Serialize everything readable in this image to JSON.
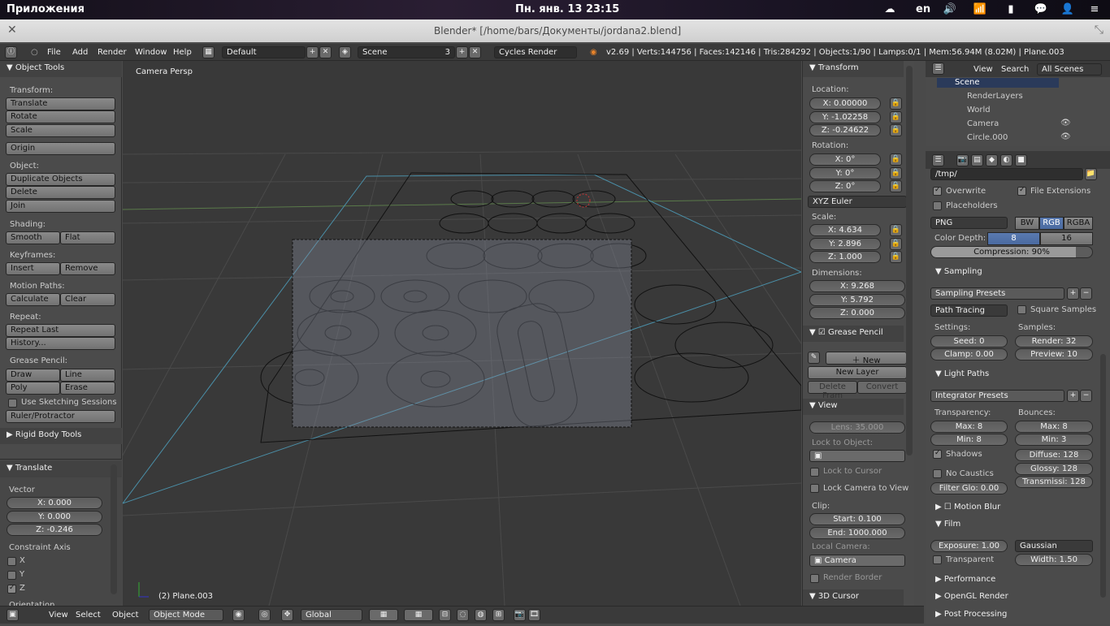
{
  "os": {
    "apps": "Приложения",
    "clock": "Пн. янв. 13 23:15",
    "lang": "en"
  },
  "window": {
    "title": "Blender* [/home/bars/Документы/jordana2.blend]"
  },
  "header": {
    "menus": [
      "File",
      "Add",
      "Render",
      "Window",
      "Help"
    ],
    "layout": "Default",
    "scene": "Scene",
    "scene_users": "3",
    "engine": "Cycles Render",
    "stats": "v2.69 | Verts:144756 | Faces:142146 | Tris:284292 | Objects:1/90 | Lamps:0/1 | Mem:56.94M (8.02M) | Plane.003"
  },
  "tools": {
    "title": "Object Tools",
    "transform_label": "Transform:",
    "translate": "Translate",
    "rotate": "Rotate",
    "scale": "Scale",
    "origin": "Origin",
    "object_label": "Object:",
    "duplicate": "Duplicate Objects",
    "delete": "Delete",
    "join": "Join",
    "shading_label": "Shading:",
    "smooth": "Smooth",
    "flat": "Flat",
    "keyframes_label": "Keyframes:",
    "insert": "Insert",
    "remove": "Remove",
    "motion_label": "Motion Paths:",
    "calculate": "Calculate",
    "clear": "Clear",
    "repeat_label": "Repeat:",
    "repeat_last": "Repeat Last",
    "history": "History...",
    "grease_label": "Grease Pencil:",
    "draw": "Draw",
    "line": "Line",
    "poly": "Poly",
    "erase": "Erase",
    "sketch": "Use Sketching Sessions",
    "ruler": "Ruler/Protractor",
    "rigid": "Rigid Body Tools"
  },
  "op": {
    "title": "Translate",
    "vector_label": "Vector",
    "x": "X: 0.000",
    "y": "Y: 0.000",
    "z": "Z: -0.246",
    "constraint_label": "Constraint Axis",
    "cx": "X",
    "cy": "Y",
    "cz": "Z",
    "orientation": "Orientation"
  },
  "viewport": {
    "label": "Camera Persp",
    "object": "(2) Plane.003"
  },
  "npanel": {
    "transform": "Transform",
    "location": "Location:",
    "lx": "X: 0.00000",
    "ly": "Y: -1.02258",
    "lz": "Z: -0.24622",
    "rotation": "Rotation:",
    "rx": "X: 0°",
    "ry": "Y: 0°",
    "rz": "Z: 0°",
    "euler": "XYZ Euler",
    "scale": "Scale:",
    "sx": "X: 4.634",
    "sy": "Y: 2.896",
    "sz": "Z: 1.000",
    "dimensions": "Dimensions:",
    "dx": "X: 9.268",
    "dy": "Y: 5.792",
    "dz": "Z: 0.000",
    "grease": "Grease Pencil",
    "new": "New",
    "new_layer": "New Layer",
    "delete_frame": "Delete Fram",
    "convert": "Convert",
    "view": "View",
    "lens": "Lens: 35.000",
    "lock_obj": "Lock to Object:",
    "lock_cursor": "Lock to Cursor",
    "lock_cam": "Lock Camera to View",
    "clip": "Clip:",
    "start": "Start: 0.100",
    "end": "End: 1000.000",
    "local_cam": "Local Camera:",
    "camera": "Camera",
    "render_border": "Render Border",
    "cursor3d": "3D Cursor"
  },
  "outliner": {
    "view": "View",
    "search": "Search",
    "all_scenes": "All Scenes",
    "scene": "Scene",
    "renderlayers": "RenderLayers",
    "world": "World",
    "camera": "Camera",
    "circle": "Circle.000"
  },
  "props": {
    "path": "/tmp/",
    "overwrite": "Overwrite",
    "file_ext": "File Extensions",
    "placeholders": "Placeholders",
    "format": "PNG",
    "bw": "BW",
    "rgb": "RGB",
    "rgba": "RGBA",
    "color_depth": "Color Depth:",
    "d8": "8",
    "d16": "16",
    "compression": "Compression: 90%",
    "sampling": "Sampling",
    "sampling_presets": "Sampling Presets",
    "path_tracing": "Path Tracing",
    "square": "Square Samples",
    "settings": "Settings:",
    "samples": "Samples:",
    "seed": "Seed: 0",
    "render": "Render: 32",
    "clamp": "Clamp: 0.00",
    "preview": "Preview: 10",
    "light_paths": "Light Paths",
    "integrator": "Integrator Presets",
    "transparency": "Transparency:",
    "bounces": "Bounces:",
    "tmax": "Max: 8",
    "bmax": "Max: 8",
    "tmin": "Min: 8",
    "bmin": "Min: 3",
    "shadows": "Shadows",
    "diffuse": "Diffuse: 128",
    "no_caustics": "No Caustics",
    "glossy": "Glossy: 128",
    "filter": "Filter Glo: 0.00",
    "transmission": "Transmissi: 128",
    "motion_blur": "Motion Blur",
    "film": "Film",
    "exposure": "Exposure: 1.00",
    "gaussian": "Gaussian",
    "transparent": "Transparent",
    "width": "Width: 1.50",
    "performance": "Performance",
    "opengl": "OpenGL Render",
    "post": "Post Processing"
  },
  "bottom": {
    "view": "View",
    "select": "Select",
    "object": "Object",
    "mode": "Object Mode",
    "orientation": "Global"
  }
}
